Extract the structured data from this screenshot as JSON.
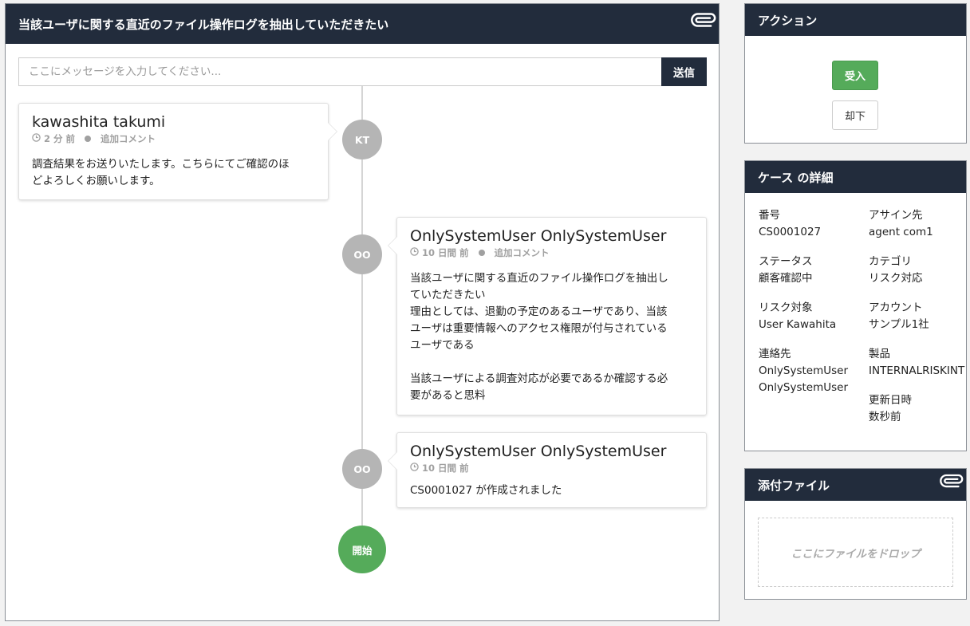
{
  "main": {
    "title": "当該ユーザに関する直近のファイル操作ログを抽出していただきたい",
    "message_placeholder": "ここにメッセージを入力してください...",
    "send_label": "送信"
  },
  "timeline": [
    {
      "initials": "KT",
      "name": "kawashita takumi",
      "time": "2 分 前",
      "kind": "追加コメント",
      "lines": [
        "調査結果をお送りいたします。こちらにてご確認のほ",
        "どよろしくお願いします。"
      ]
    },
    {
      "initials": "OO",
      "name": "OnlySystemUser OnlySystemUser",
      "time": "10 日間 前",
      "kind": "追加コメント",
      "lines": [
        "当該ユーザに関する直近のファイル操作ログを抽出し",
        "ていただきたい",
        "理由としては、退勤の予定のあるユーザであり、当該",
        "ユーザは重要情報へのアクセス権限が付与されている",
        "ユーザである",
        "",
        "当該ユーザによる調査対応が必要であるか確認する必",
        "要があると思料"
      ]
    },
    {
      "initials": "OO",
      "name": "OnlySystemUser OnlySystemUser",
      "time": "10 日間 前",
      "lines": [
        "CS0001027 が作成されました"
      ]
    }
  ],
  "start_label": "開始",
  "actions": {
    "title": "アクション",
    "accept_label": "受入",
    "reject_label": "却下"
  },
  "details": {
    "title": "ケース の詳細",
    "fields": [
      {
        "label": "番号",
        "value": "CS0001027"
      },
      {
        "label": "アサイン先",
        "value": "agent com1"
      },
      {
        "label": "ステータス",
        "value": "顧客確認中"
      },
      {
        "label": "カテゴリ",
        "value": "リスク対応"
      },
      {
        "label": "リスク対象",
        "value": "User Kawahita"
      },
      {
        "label": "アカウント",
        "value": "サンプル1社"
      },
      {
        "label": "連絡先",
        "value": "OnlySystemUser",
        "value2": "OnlySystemUser"
      },
      {
        "label": "製品",
        "value": "INTERNALRISKINT"
      },
      {
        "label": "更新日時",
        "value": "数秒前"
      }
    ]
  },
  "attachments": {
    "title": "添付ファイル",
    "drop_text": "ここにファイルをドロップ"
  },
  "colors": {
    "header_bg": "#222c3c",
    "accent_green": "#55ab5a",
    "avatar_gray": "#b5b5b5"
  }
}
